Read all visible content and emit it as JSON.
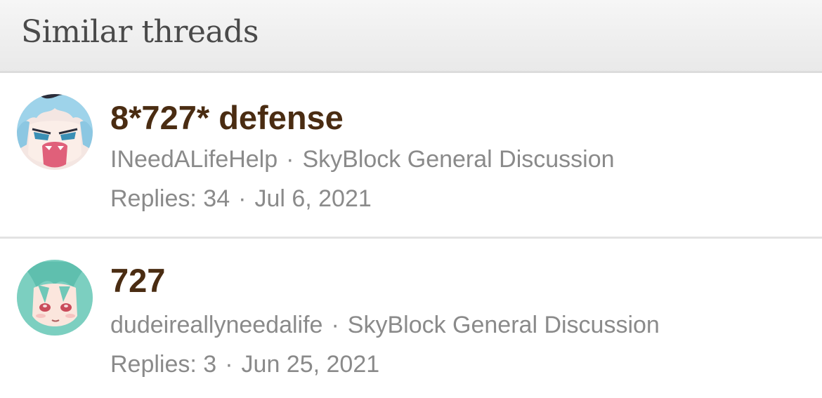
{
  "header": {
    "title": "Similar threads"
  },
  "threads": [
    {
      "title": "8*727* defense",
      "author": "INeedALifeHelp",
      "forum": "SkyBlock General Discussion",
      "replies_label": "Replies: 34",
      "date": "Jul 6, 2021",
      "separator": "·",
      "avatar_icon": "anime-avatar-blue-hair-icon"
    },
    {
      "title": "727",
      "author": "dudeireallyneedalife",
      "forum": "SkyBlock General Discussion",
      "replies_label": "Replies: 3",
      "date": "Jun 25, 2021",
      "separator": "·",
      "avatar_icon": "anime-avatar-teal-hair-icon"
    }
  ],
  "colors": {
    "title": "#4a2c12",
    "meta": "#8a8a8a",
    "header_text": "#4a4a4a",
    "header_bg": "#efefef"
  }
}
